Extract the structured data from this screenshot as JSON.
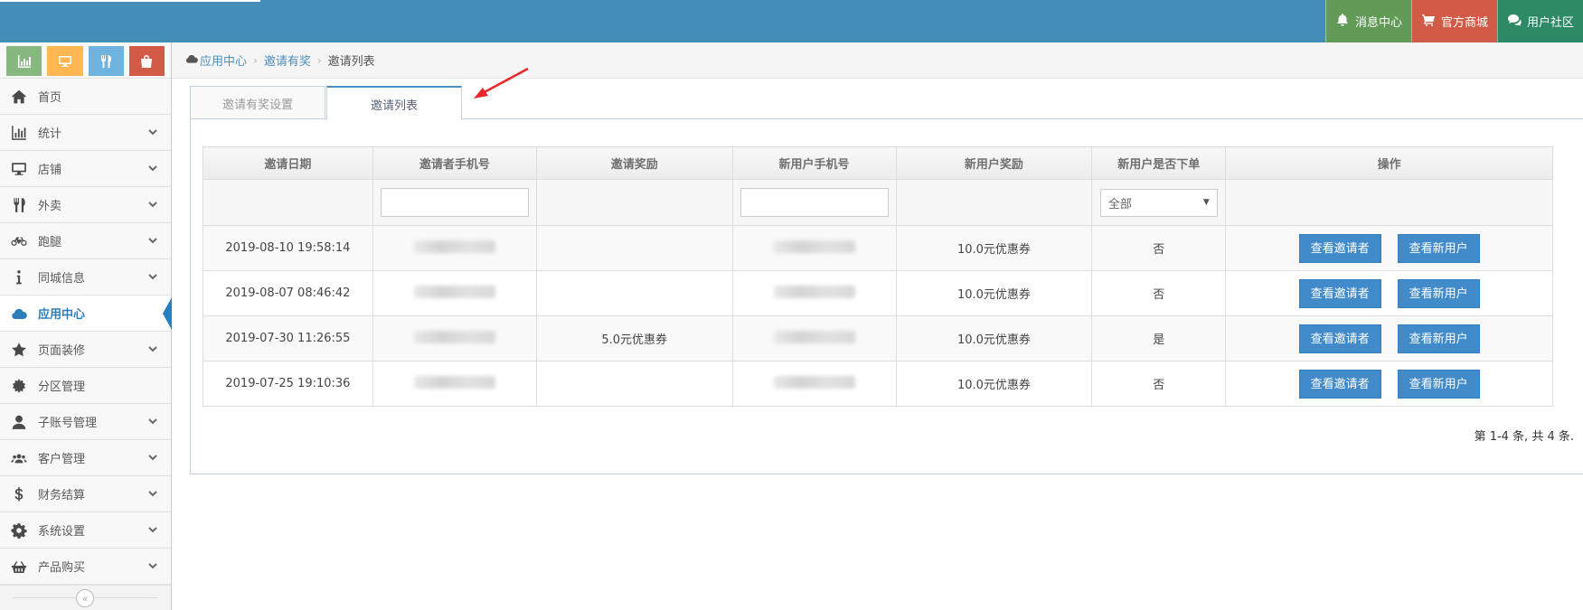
{
  "topbar": {
    "buttons": [
      {
        "label": "消息中心",
        "icon": "bell-icon",
        "color": "#629b58"
      },
      {
        "label": "官方商城",
        "icon": "cart-icon",
        "color": "#d15b47"
      },
      {
        "label": "用户社区",
        "icon": "comments-icon",
        "color": "#2e8965"
      }
    ]
  },
  "sidebar": {
    "shortcuts": [
      {
        "icon": "chart-icon",
        "color": "#87b87f"
      },
      {
        "icon": "desktop-icon",
        "color": "#ffb752"
      },
      {
        "icon": "cutlery-icon",
        "color": "#6fb3e0"
      },
      {
        "icon": "bag-icon",
        "color": "#d15b47"
      }
    ],
    "items": [
      {
        "label": "首页",
        "icon": "home-icon"
      },
      {
        "label": "统计",
        "icon": "bar-chart-icon"
      },
      {
        "label": "店铺",
        "icon": "desktop-icon"
      },
      {
        "label": "外卖",
        "icon": "cutlery-icon"
      },
      {
        "label": "跑腿",
        "icon": "bicycle-icon"
      },
      {
        "label": "同城信息",
        "icon": "info-icon"
      },
      {
        "label": "应用中心",
        "icon": "cloud-icon"
      },
      {
        "label": "页面装修",
        "icon": "star-icon"
      },
      {
        "label": "分区管理",
        "icon": "cog-burst-icon"
      },
      {
        "label": "子账号管理",
        "icon": "user-icon"
      },
      {
        "label": "客户管理",
        "icon": "users-icon"
      },
      {
        "label": "财务结算",
        "icon": "dollar-icon"
      },
      {
        "label": "系统设置",
        "icon": "gear-icon"
      },
      {
        "label": "产品购买",
        "icon": "basket-icon"
      }
    ],
    "collapse_glyph": "«"
  },
  "breadcrumb": {
    "items": [
      "应用中心",
      "邀请有奖"
    ],
    "current": "邀请列表"
  },
  "tabs": [
    {
      "label": "邀请有奖设置",
      "active": false
    },
    {
      "label": "邀请列表",
      "active": true
    }
  ],
  "table": {
    "columns": [
      "邀请日期",
      "邀请者手机号",
      "邀请奖励",
      "新用户手机号",
      "新用户奖励",
      "新用户是否下单",
      "操作"
    ],
    "filter_select_value": "全部",
    "view_inviter_label": "查看邀请者",
    "view_new_user_label": "查看新用户",
    "rows": [
      {
        "date": "2019-08-10 19:58:14",
        "inviter_reward": "",
        "new_user_reward": "10.0元优惠券",
        "ordered": "否"
      },
      {
        "date": "2019-08-07 08:46:42",
        "inviter_reward": "",
        "new_user_reward": "10.0元优惠券",
        "ordered": "否"
      },
      {
        "date": "2019-07-30 11:26:55",
        "inviter_reward": "5.0元优惠券",
        "new_user_reward": "10.0元优惠券",
        "ordered": "是"
      },
      {
        "date": "2019-07-25 19:10:36",
        "inviter_reward": "",
        "new_user_reward": "10.0元优惠券",
        "ordered": "否"
      }
    ]
  },
  "pager": {
    "info": "第 1-4 条, 共 4 条."
  },
  "colors": {
    "topbar": "#438eb9",
    "accent": "#2b7dbc",
    "button": "#428bca",
    "annotation_arrow": "#e8272a"
  }
}
